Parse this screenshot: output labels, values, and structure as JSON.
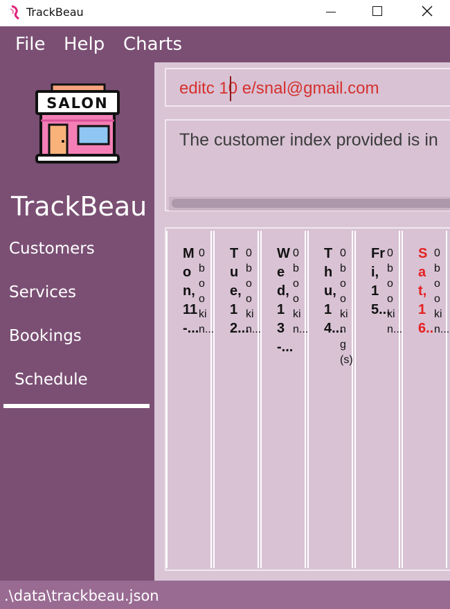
{
  "window": {
    "title": "TrackBeau"
  },
  "menubar": {
    "items": [
      "File",
      "Help",
      "Charts"
    ]
  },
  "sidebar": {
    "logo_text": "SALON",
    "brand": "TrackBeau",
    "items": [
      {
        "label": "Customers"
      },
      {
        "label": "Services"
      },
      {
        "label": "Bookings"
      },
      {
        "label": "Schedule",
        "selected": true
      }
    ]
  },
  "command": {
    "value": "editc 10 e/snal@gmail.com"
  },
  "result": {
    "text": "The customer index provided is in"
  },
  "schedule": {
    "days": [
      {
        "name": "Mon, 11-...",
        "count": "0 booki n..."
      },
      {
        "name": "Tue, 12...",
        "count": "0 booki n..."
      },
      {
        "name": "Wed, 13-...",
        "count": "0 booki n..."
      },
      {
        "name": "Thu, 14...",
        "count": "0 booki ng(s)"
      },
      {
        "name": "Fri, 15...",
        "count": "0 booki n..."
      },
      {
        "name": "Sat, 16..",
        "count": "0 booki n...",
        "today": true
      }
    ]
  },
  "status": {
    "path": ".\\data\\trackbeau.json"
  },
  "colors": {
    "sidebar": "#7b4f74",
    "main": "#d9c5d6",
    "command_text": "#d6302d",
    "today": "#e52020"
  }
}
